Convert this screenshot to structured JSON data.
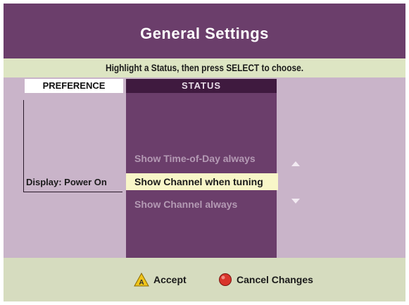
{
  "title": "General Settings",
  "instruction": "Highlight a Status, then press SELECT to choose.",
  "columns": {
    "preference": "PREFERENCE",
    "status": "STATUS"
  },
  "preference_label": "Display: Power On",
  "options": [
    "Show Time-of-Day always",
    "Show Channel when tuning",
    "Show Channel always"
  ],
  "selected_index": 1,
  "footer": {
    "accept_label": "Accept",
    "cancel_label": "Cancel Changes"
  },
  "icons": {
    "accept": "yellow-triangle-a-icon",
    "cancel": "red-circle-icon",
    "up": "arrow-up-icon",
    "down": "arrow-down-icon"
  },
  "colors": {
    "background": "#6b3e6b",
    "instruction_bar": "#dde5c3",
    "body": "#c9b4c9",
    "status_column": "#6b3e6b",
    "status_header": "#3f1a3f",
    "selected_option": "#f8f6c8",
    "footer": "#d6dcbf",
    "accept": "#f0c419",
    "cancel": "#d9352b"
  }
}
